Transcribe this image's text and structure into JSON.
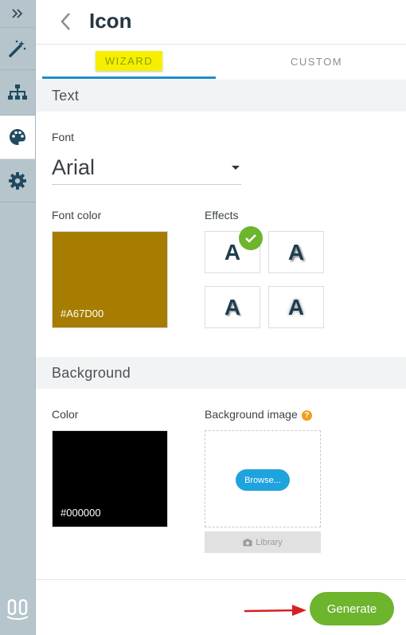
{
  "header": {
    "title": "Icon"
  },
  "tabs": [
    {
      "label": "WIZARD"
    },
    {
      "label": "CUSTOM"
    }
  ],
  "sections": {
    "text": "Text",
    "background": "Background"
  },
  "text": {
    "font_label": "Font",
    "font_value": "Arial",
    "font_color_label": "Font color",
    "font_color_hex": "#A67D00",
    "effects_label": "Effects",
    "effect_letter": "A"
  },
  "background": {
    "color_label": "Color",
    "color_hex": "#000000",
    "image_label": "Background image",
    "help_glyph": "?",
    "browse_label": "Browse...",
    "library_label": "Library"
  },
  "footer": {
    "generate_label": "Generate"
  },
  "colors": {
    "accent_blue": "#1F8CCB",
    "generate_green": "#6CB52D",
    "highlight_yellow": "#F6F000",
    "font_color": "#A67D00",
    "background_color": "#000000"
  },
  "icons": [
    "expand-icon",
    "magic-wand-icon",
    "sitemap-icon",
    "palette-icon",
    "gear-icon",
    "logo-icon",
    "back-chevron-icon",
    "checkmark-icon",
    "camera-icon",
    "arrow-annotation"
  ]
}
